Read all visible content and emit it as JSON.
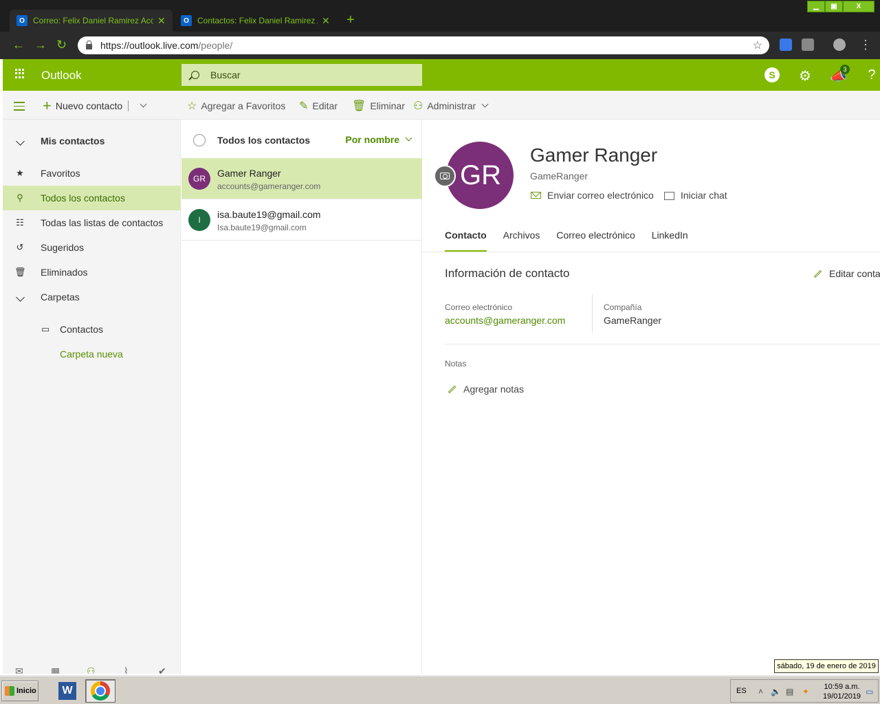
{
  "browser": {
    "tabs": [
      {
        "title": "Correo: Felix Daniel Ramirez Acosta",
        "active": true
      },
      {
        "title": "Contactos: Felix Daniel Ramirez Acosta",
        "active": false
      }
    ],
    "url_host": "https://outlook.live.com",
    "url_path": "/people/"
  },
  "header": {
    "app_name": "Outlook",
    "search_placeholder": "Buscar",
    "notification_count": "3",
    "accent_color": "#80b900"
  },
  "commands": {
    "new_contact": "Nuevo contacto",
    "add_favorites": "Agregar a Favoritos",
    "edit": "Editar",
    "delete": "Eliminar",
    "manage": "Administrar"
  },
  "nav": {
    "my_contacts": "Mis contactos",
    "favorites": "Favoritos",
    "all_contacts": "Todos los contactos",
    "all_lists": "Todas las listas de contactos",
    "suggested": "Sugeridos",
    "deleted": "Eliminados",
    "folders": "Carpetas",
    "contacts_folder": "Contactos",
    "new_folder": "Carpeta nueva"
  },
  "list": {
    "title": "Todos los contactos",
    "sort": "Por nombre",
    "contacts": [
      {
        "initials": "GR",
        "name": "Gamer Ranger",
        "email": "accounts@gameranger.com",
        "color": "#7b2f78",
        "selected": true
      },
      {
        "initials": "I",
        "name": "isa.baute19@gmail.com",
        "email": "Isa.baute19@gmail.com",
        "color": "#1f6e43",
        "selected": false
      }
    ]
  },
  "detail": {
    "initials": "GR",
    "name": "Gamer Ranger",
    "company": "GameRanger",
    "send_email": "Enviar correo electrónico",
    "start_chat": "Iniciar chat",
    "tabs": [
      "Contacto",
      "Archivos",
      "Correo electrónico",
      "LinkedIn"
    ],
    "info_title": "Información de contacto",
    "edit_contact": "Editar contacto",
    "email_label": "Correo electrónico",
    "email_value": "accounts@gameranger.com",
    "company_label": "Compañía",
    "company_value": "GameRanger",
    "notes_label": "Notas",
    "add_notes": "Agregar notas"
  },
  "taskbar": {
    "start": "Inicio",
    "lang": "ES",
    "time": "10:59 a.m.",
    "date": "19/01/2019",
    "tooltip": "sábado, 19 de enero de 2019"
  }
}
